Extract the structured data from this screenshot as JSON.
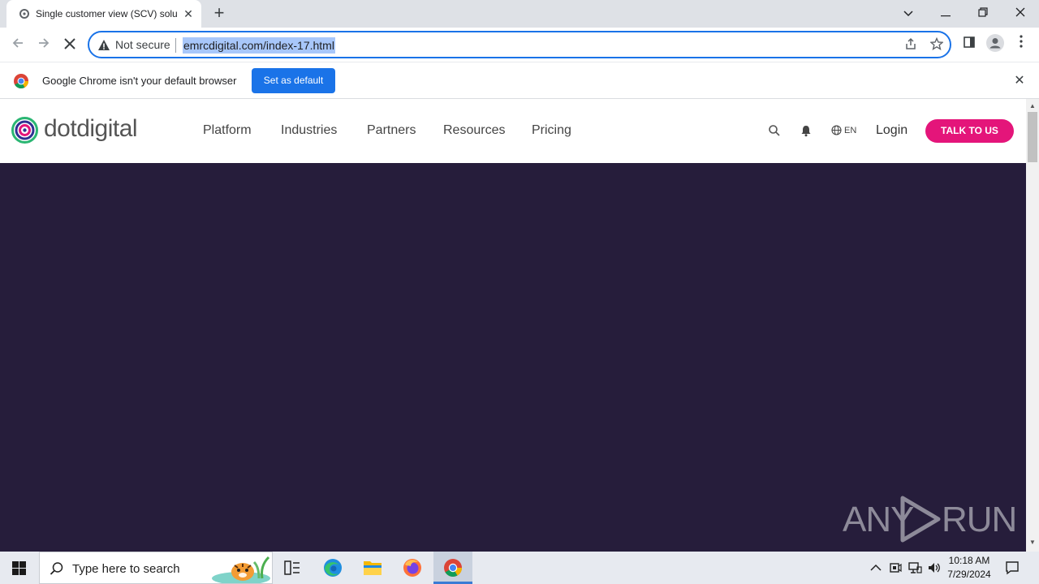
{
  "browser": {
    "tab_title": "Single customer view (SCV) solu",
    "new_tab": "+",
    "security_label": "Not secure",
    "url": "emrcdigital.com/index-17.html",
    "infobar_text": "Google Chrome isn't your default browser",
    "set_default_label": "Set as default"
  },
  "site": {
    "logo_text": "dotdigital",
    "nav": [
      "Platform",
      "Industries",
      "Partners",
      "Resources",
      "Pricing"
    ],
    "lang": "EN",
    "login": "Login",
    "cta": "TALK TO US",
    "brand_color": "#e4157a",
    "hero_color": "#261d3b"
  },
  "watermark": {
    "left": "ANY",
    "right": "RUN"
  },
  "taskbar": {
    "search_placeholder": "Type here to search",
    "time": "10:18 AM",
    "date": "7/29/2024"
  }
}
